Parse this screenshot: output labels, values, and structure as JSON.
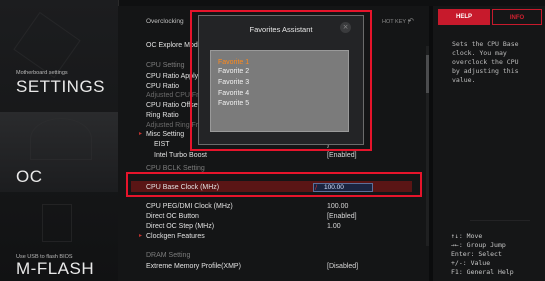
{
  "left_panel": {
    "settings": {
      "caption": "Motherboard settings",
      "title": "SETTINGS"
    },
    "oc": {
      "title": "OC"
    },
    "mflash": {
      "caption": "Use USB to flash BIOS",
      "title": "M-FLASH"
    }
  },
  "main": {
    "breadcrumb": "Overclocking",
    "hotkey_label": "HOT KEY",
    "hotkey_separator": "|",
    "hotkey_icon": "undo-icon",
    "rows": [
      {
        "label": "OC Explore Mode",
        "value": ""
      },
      {
        "label": "CPU Setting",
        "value": "",
        "type": "section"
      },
      {
        "label": "CPU Ratio Apply",
        "value": "]"
      },
      {
        "label": "CPU Ratio",
        "value": ""
      },
      {
        "label": "Adjusted CPU Frequency",
        "value": "",
        "type": "dim"
      },
      {
        "label": "CPU Ratio Offset",
        "value": ""
      },
      {
        "label": "Ring Ratio",
        "value": ""
      },
      {
        "label": "Adjusted Ring Frequency",
        "value": "",
        "type": "dim"
      },
      {
        "label": "Misc Setting",
        "value": "",
        "type": "group"
      },
      {
        "label": "EIST",
        "value": "]"
      },
      {
        "label": "Intel Turbo Boost",
        "value": "[Enabled]"
      },
      {
        "label": "CPU BCLK Setting",
        "value": "",
        "type": "section"
      },
      {
        "label": "CPU Base Clock (MHz)",
        "value": "100.00",
        "type": "selected"
      },
      {
        "label": "CPU PEG/DMI Clock (MHz)",
        "value": "100.00"
      },
      {
        "label": "Direct OC Button",
        "value": "[Enabled]"
      },
      {
        "label": "Direct OC Step (MHz)",
        "value": "1.00"
      },
      {
        "label": "Clockgen Features",
        "value": "",
        "type": "group"
      },
      {
        "label": "DRAM Setting",
        "value": "",
        "type": "section"
      },
      {
        "label": "Extreme Memory Profile(XMP)",
        "value": "[Disabled]"
      }
    ]
  },
  "dialog": {
    "title": "Favorites Assistant",
    "close_icon": "close-icon",
    "favorites": [
      "Favorite 1",
      "Favorite 2",
      "Favorite 3",
      "Favorite 4",
      "Favorite 5"
    ],
    "selected_index": 0
  },
  "right_panel": {
    "tabs": {
      "help": "HELP",
      "info": "INFO"
    },
    "help_text": [
      "Sets the CPU Base",
      "clock. You may",
      "overclock the CPU",
      "by adjusting this",
      "value."
    ],
    "key_hints": [
      "↑↓: Move",
      "→←: Group Jump",
      "Enter: Select",
      "+/-: Value",
      "F1: General Help"
    ]
  },
  "colors": {
    "accent": "#e6142b",
    "highlight_row": "#5a1515",
    "favorite_selected": "#ff8a1c"
  }
}
